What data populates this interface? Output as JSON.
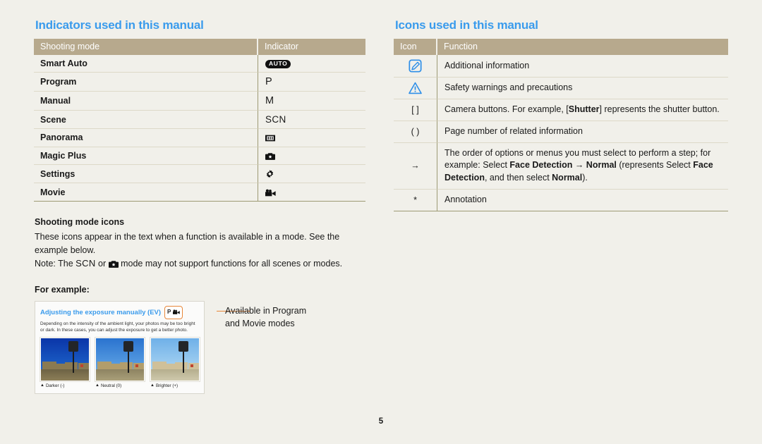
{
  "left": {
    "section_title": "Indicators used in this manual",
    "table": {
      "headers": [
        "Shooting mode",
        "Indicator"
      ],
      "rows": [
        {
          "mode": "Smart Auto",
          "indicator_text": "AUTO",
          "indicator_icon": "auto-pill-icon"
        },
        {
          "mode": "Program",
          "indicator_text": "P",
          "indicator_icon": "letter-p-icon"
        },
        {
          "mode": "Manual",
          "indicator_text": "M",
          "indicator_icon": "letter-m-icon"
        },
        {
          "mode": "Scene",
          "indicator_text": "SCN",
          "indicator_icon": "letters-scn-icon"
        },
        {
          "mode": "Panorama",
          "indicator_text": "",
          "indicator_icon": "panorama-filmstrip-icon"
        },
        {
          "mode": "Magic Plus",
          "indicator_text": "",
          "indicator_icon": "camera-star-icon"
        },
        {
          "mode": "Settings",
          "indicator_text": "",
          "indicator_icon": "gear-icon"
        },
        {
          "mode": "Movie",
          "indicator_text": "",
          "indicator_icon": "movie-camera-icon"
        }
      ]
    },
    "note": {
      "heading": "Shooting mode icons",
      "line1": "These icons appear in the text when a function is available in a mode. See the example below.",
      "note_prefix": "Note: The",
      "note_mid": "or",
      "note_suffix": "mode may not support functions for all scenes or modes.",
      "note_icon_1": "letters-scn-icon",
      "note_icon_2": "camera-star-icon"
    },
    "for_example_label": "For example:",
    "example": {
      "title": "Adjusting the exposure manually (EV)",
      "badge_letter": "P",
      "badge_icon": "movie-camera-icon",
      "description": "Depending on the intensity of the ambient light, your photos may be too bright or dark. In these cases, you can adjust the exposure to get a better photo.",
      "thumbs": [
        {
          "caption": "Darker (-)"
        },
        {
          "caption": "Neutral (0)"
        },
        {
          "caption": "Brighter (+)"
        }
      ],
      "callout_line1": "Available in Program",
      "callout_line2": "and Movie modes"
    }
  },
  "right": {
    "section_title": "Icons used in this manual",
    "table": {
      "headers": [
        "Icon",
        "Function"
      ],
      "rows": [
        {
          "icon_name": "note-pen-icon",
          "icon_text": "",
          "function_html": "Additional information"
        },
        {
          "icon_name": "warning-triangle-icon",
          "icon_text": "",
          "function_html": "Safety warnings and precautions"
        },
        {
          "icon_name": "square-brackets-icon",
          "icon_text": "[ ]",
          "function_html": "Camera buttons. For example, [<b>Shutter</b>] represents the shutter button."
        },
        {
          "icon_name": "parentheses-icon",
          "icon_text": "( )",
          "function_html": "Page number of related information"
        },
        {
          "icon_name": "right-arrow-icon",
          "icon_text": "→",
          "function_html": "The order of options or menus you must select to perform a step; for example: Select <b>Face Detection</b> → <b>Normal</b> (represents Select <b>Face Detection</b>, and then select <b>Normal</b>)."
        },
        {
          "icon_name": "asterisk-icon",
          "icon_text": "*",
          "function_html": "Annotation"
        }
      ]
    }
  },
  "footer": {
    "page_number": "5"
  },
  "colors": {
    "background": "#f1f0ea",
    "heading_blue": "#3a9bec",
    "table_header_tan": "#b7a98d",
    "rule_olive": "#9d9a74",
    "row_rule": "#ddd9c8",
    "accent_orange": "#e8873a"
  }
}
